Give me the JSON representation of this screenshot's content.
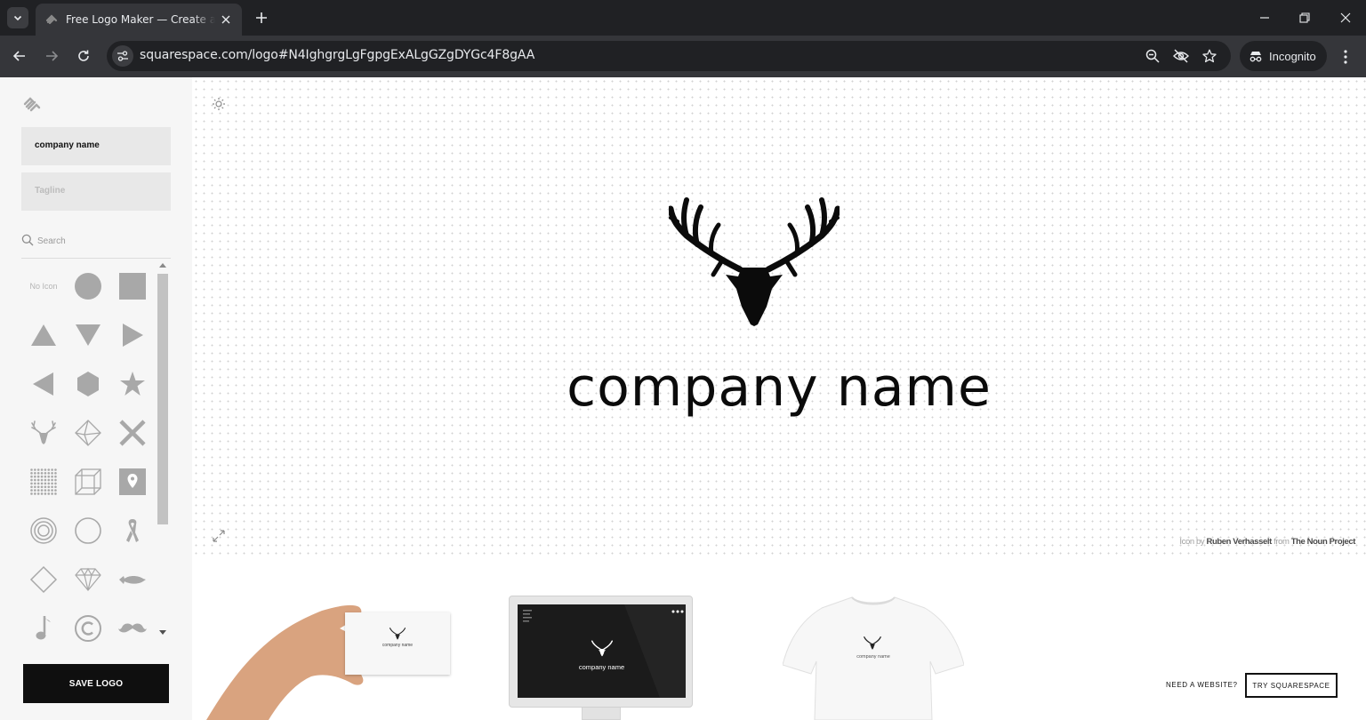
{
  "browser": {
    "tab_title": "Free Logo Maker — Create a Logo",
    "url": "squarespace.com/logo#N4IghgrgLgFgpgExALgGZgDYGc4F8gAA",
    "incognito_label": "Incognito",
    "colors": {
      "chrome_dark": "#202124",
      "chrome_mid": "#35363a",
      "text": "#e8eaed"
    }
  },
  "sidebar": {
    "company_name_value": "company name",
    "tagline_placeholder": "Tagline",
    "search_placeholder": "Search",
    "no_icon_label": "No Icon",
    "icons": [
      "circle-icon",
      "square-icon",
      "triangle-up-icon",
      "triangle-down-icon",
      "triangle-right-icon",
      "triangle-left-icon",
      "hexagon-icon",
      "star-icon",
      "stag-icon",
      "diamond-3d-icon",
      "x-icon",
      "dot-grid-icon",
      "cube-icon",
      "map-pin-icon",
      "concentric-circles-icon",
      "circle-outline-icon",
      "ribbon-icon",
      "diamond-outline-icon",
      "gem-icon",
      "fish-icon",
      "music-note-icon",
      "copyright-icon",
      "mustache-icon"
    ],
    "save_label": "SAVE LOGO"
  },
  "canvas": {
    "logo_icon": "stag-icon",
    "company_name": "company name",
    "credit": {
      "prefix": "Icon by",
      "author": "Ruben Verhasselt",
      "middle": "from",
      "source": "The Noun Project"
    }
  },
  "mockups": {
    "card_name": "company name",
    "monitor_name": "company name",
    "tee_name": "company name"
  },
  "footer": {
    "need_website": "NEED A WEBSITE?",
    "try_label": "TRY SQUARESPACE"
  }
}
